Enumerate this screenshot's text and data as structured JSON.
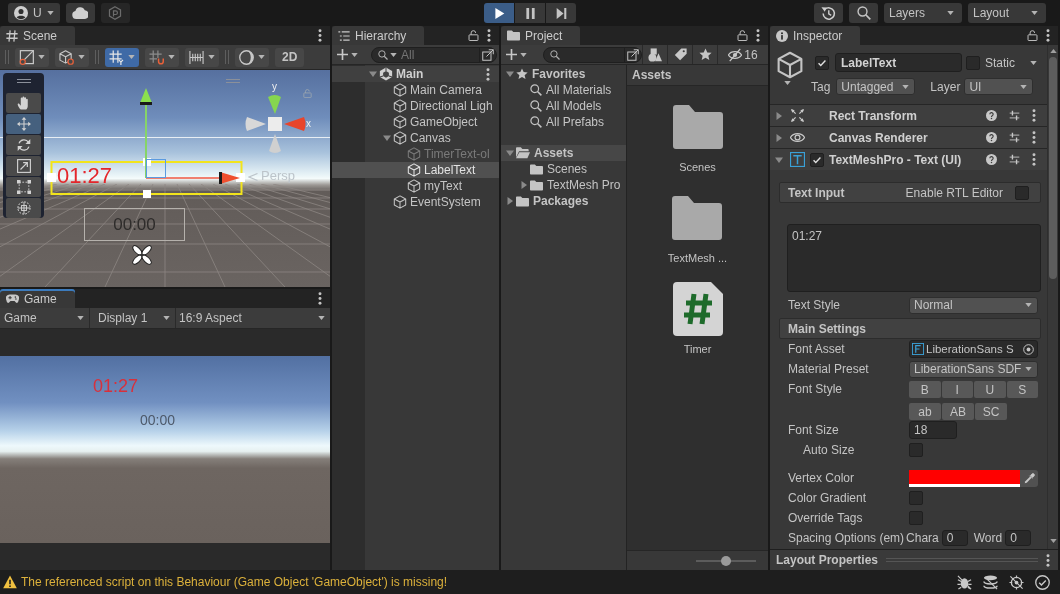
{
  "toolbar": {
    "account": {
      "label": "U"
    },
    "play_controls": [
      {
        "kind": "play",
        "on": true
      },
      {
        "kind": "pause",
        "on": false
      },
      {
        "kind": "step",
        "on": false
      }
    ],
    "layers": "Layers",
    "layout": "Layout"
  },
  "scene": {
    "tab": "Scene",
    "focused": false,
    "tool_groups": [
      [
        {
          "kind": "drawmode",
          "on": false
        },
        {
          "kind": "shading",
          "on": false
        }
      ],
      [
        {
          "kind": "gridsnap",
          "on": true
        },
        {
          "kind": "increment",
          "on": false
        },
        {
          "kind": "grid",
          "on": false
        }
      ],
      [
        {
          "kind": "effects",
          "on": false
        },
        {
          "kind": "dimension",
          "label": "2D",
          "on": false
        }
      ]
    ],
    "tools": [
      {
        "kind": "hand",
        "selected": false
      },
      {
        "kind": "move",
        "selected": true
      },
      {
        "kind": "rotate",
        "selected": false
      },
      {
        "kind": "scale",
        "selected": false
      },
      {
        "kind": "rect",
        "selected": false
      },
      {
        "kind": "transform",
        "selected": false
      }
    ],
    "objects": [
      {
        "kind": "timer",
        "text": "01:27"
      },
      {
        "kind": "frame",
        "text": "00:00"
      }
    ],
    "gizmo": {
      "axis_y": "y",
      "axis_x": "x",
      "projection": "Persp"
    }
  },
  "game": {
    "tab": "Game",
    "focused": true,
    "dropdowns": [
      "Game",
      "Display 1",
      "16:9 Aspect"
    ],
    "texts": [
      {
        "kind": "timer",
        "text": "01:27"
      },
      {
        "kind": "label",
        "text": "00:00"
      }
    ]
  },
  "hierarchy": {
    "tab": "Hierarchy",
    "focused": false,
    "search": {
      "placeholder": "All"
    },
    "tree": [
      {
        "label": "Main",
        "kind": "scene",
        "expanded": true,
        "selected": false,
        "active": true,
        "children": [
          {
            "label": "Main Camera",
            "kind": "object",
            "selected": false,
            "active": true
          },
          {
            "label": "Directional Ligh",
            "kind": "object",
            "selected": false,
            "active": true
          },
          {
            "label": "GameObject",
            "kind": "object",
            "selected": false,
            "active": true
          },
          {
            "label": "Canvas",
            "kind": "object",
            "expanded": true,
            "selected": false,
            "active": true,
            "children": [
              {
                "label": "TimerText-ol",
                "kind": "object",
                "selected": false,
                "active": false
              },
              {
                "label": "LabelText",
                "kind": "object",
                "selected": true,
                "active": true
              },
              {
                "label": "myText",
                "kind": "object",
                "selected": false,
                "active": true
              }
            ]
          },
          {
            "label": "EventSystem",
            "kind": "object",
            "selected": false,
            "active": true
          }
        ]
      }
    ]
  },
  "project": {
    "tab": "Project",
    "focused": false,
    "hidden_count": "16",
    "favorites": {
      "label": "Favorites",
      "expanded": true,
      "selected": false,
      "items": [
        {
          "label": "All Materials",
          "selected": false
        },
        {
          "label": "All Models",
          "selected": false
        },
        {
          "label": "All Prefabs",
          "selected": false
        }
      ]
    },
    "folders": [
      {
        "label": "Assets",
        "expanded": true,
        "selected": true,
        "children": [
          {
            "label": "Scenes",
            "selected": false
          },
          {
            "label": "TextMesh Pro",
            "expanded": false,
            "selected": false
          }
        ]
      },
      {
        "label": "Packages",
        "expanded": false,
        "selected": false
      }
    ],
    "breadcrumb": "Assets",
    "items": [
      {
        "kind": "folder",
        "label": "Scenes"
      },
      {
        "kind": "folder",
        "label": "TextMesh ..."
      },
      {
        "kind": "script",
        "label": "Timer"
      }
    ],
    "zoom_slider": {
      "level": 0.5
    }
  },
  "inspector": {
    "tab": "Inspector",
    "focused": false,
    "object": {
      "active": true,
      "name": "LabelText",
      "static": false,
      "static_label": "Static",
      "tag_label": "Tag",
      "tag": "Untagged",
      "layer_label": "Layer",
      "layer": "UI"
    },
    "components": [
      {
        "kind": "recttransform",
        "name": "Rect Transform",
        "expanded": false
      },
      {
        "kind": "renderer",
        "name": "Canvas Renderer",
        "expanded": false
      },
      {
        "kind": "text",
        "name": "TextMeshPro - Text (UI)",
        "expanded": true,
        "enabled": true
      }
    ],
    "text_input": {
      "header": "Text Input",
      "rtl_label": "Enable RTL Editor",
      "rtl": false,
      "text": "01:27"
    },
    "text_style": {
      "label": "Text Style",
      "value": "Normal"
    },
    "main_settings": {
      "header": "Main Settings",
      "fields": [
        {
          "kind": "object",
          "label": "Font Asset",
          "value": "LiberationSans S"
        },
        {
          "kind": "dropdown",
          "label": "Material Preset",
          "value": "LiberationSans SDF"
        },
        {
          "kind": "toggles",
          "label": "Font Style",
          "rows": [
            [
              {
                "label": "B",
                "on": false
              },
              {
                "label": "I",
                "on": false
              },
              {
                "label": "U",
                "on": false
              },
              {
                "label": "S",
                "on": false
              }
            ],
            [
              {
                "label": "ab",
                "on": false
              },
              {
                "label": "AB",
                "on": false
              },
              {
                "label": "SC",
                "on": false
              }
            ]
          ]
        },
        {
          "kind": "number",
          "label": "Font Size",
          "value": "18",
          "children": [
            {
              "kind": "checkbox",
              "label": "Auto Size",
              "checked": false
            }
          ]
        },
        {
          "kind": "color",
          "label": "Vertex Color",
          "color": "#ff0000"
        },
        {
          "kind": "checkbox",
          "label": "Color Gradient",
          "checked": false
        },
        {
          "kind": "checkbox",
          "label": "Override Tags",
          "checked": false
        },
        {
          "kind": "spacing",
          "label": "Spacing Options (em)",
          "parts": [
            {
              "label": "Chara",
              "value": "0"
            },
            {
              "label": "Word",
              "value": "0"
            }
          ]
        }
      ]
    },
    "footer": "Layout Properties"
  },
  "status_bar": {
    "kind": "warning",
    "message": "The referenced script on this Behaviour (Game Object 'GameObject') is missing!"
  }
}
